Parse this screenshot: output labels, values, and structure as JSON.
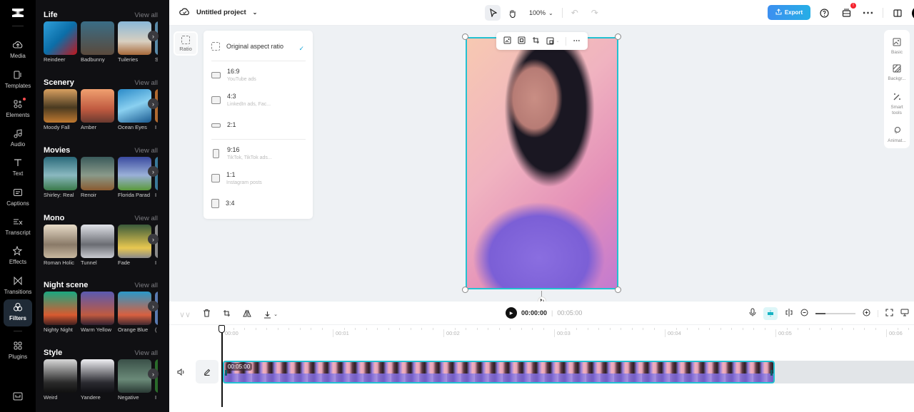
{
  "app": {
    "name": "CapCut"
  },
  "rail": {
    "items": [
      {
        "label": "Media",
        "icon": "cloud-upload-icon"
      },
      {
        "label": "Templates",
        "icon": "templates-icon"
      },
      {
        "label": "Elements",
        "icon": "elements-icon",
        "notification": true
      },
      {
        "label": "Audio",
        "icon": "music-note-icon"
      },
      {
        "label": "Text",
        "icon": "text-icon"
      },
      {
        "label": "Captions",
        "icon": "captions-icon"
      },
      {
        "label": "Transcript",
        "icon": "transcript-icon"
      },
      {
        "label": "Effects",
        "icon": "effects-icon"
      },
      {
        "label": "Transitions",
        "icon": "transitions-icon"
      },
      {
        "label": "Filters",
        "icon": "filters-icon",
        "active": true
      },
      {
        "label": "Plugins",
        "icon": "plugins-icon"
      }
    ],
    "bottom_icon": "keyboard-shortcuts-icon"
  },
  "filters": {
    "view_all_label": "View all",
    "sections": [
      {
        "title": "Life",
        "items": [
          "Reindeer",
          "Badbunny",
          "Tuileries",
          "S"
        ]
      },
      {
        "title": "Scenery",
        "items": [
          "Moody Fall",
          "Amber",
          "Ocean Eyes",
          "I"
        ]
      },
      {
        "title": "Movies",
        "items": [
          "Shirley: Real",
          "Renoir",
          "Florida Parad",
          "I"
        ]
      },
      {
        "title": "Mono",
        "items": [
          "Roman Holic",
          "Tunnel",
          "Fade",
          "I"
        ]
      },
      {
        "title": "Night scene",
        "items": [
          "Nighty Night",
          "Warm Yellow",
          "Orange Blue",
          "("
        ]
      },
      {
        "title": "Style",
        "items": [
          "Weird",
          "Yandere",
          "Negative",
          "I"
        ]
      }
    ]
  },
  "topbar": {
    "project_name": "Untitled project",
    "zoom": "100%",
    "export_label": "Export",
    "notification_count": "!"
  },
  "canvas": {
    "ratio_label": "Ratio",
    "ratio_menu": [
      {
        "label": "Original aspect ratio",
        "sub": "",
        "selected": true
      },
      {
        "label": "16:9",
        "sub": "YouTube ads"
      },
      {
        "label": "4:3",
        "sub": "LinkedIn ads, Fac..."
      },
      {
        "label": "2:1",
        "sub": ""
      },
      {
        "label": "9:16",
        "sub": "TikTok, TikTok ads..."
      },
      {
        "label": "1:1",
        "sub": "Instagram posts"
      },
      {
        "label": "3:4",
        "sub": ""
      }
    ],
    "right_panel": [
      {
        "label": "Basic",
        "icon": "image-icon"
      },
      {
        "label": "Backgr...",
        "icon": "background-icon"
      },
      {
        "label": "Smart tools",
        "icon": "magic-wand-icon"
      },
      {
        "label": "Animat...",
        "icon": "animation-icon"
      }
    ]
  },
  "timeline": {
    "current_time": "00:00:00",
    "total_time": "00:05:00",
    "zoom_level": 0.25,
    "ruler_labels": [
      "00:00",
      "00:01",
      "00:02",
      "00:03",
      "00:04",
      "00:05",
      "00:06"
    ],
    "clip_duration": "00:05:00"
  }
}
